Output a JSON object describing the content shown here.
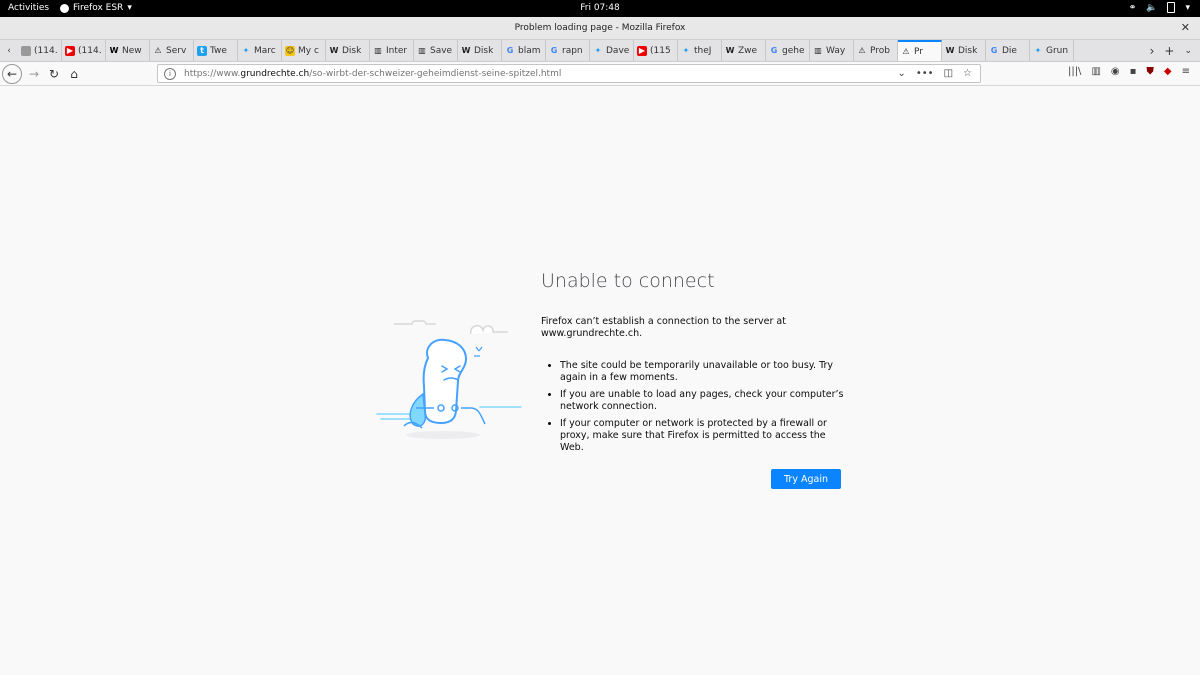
{
  "top_bar": {
    "activities": "Activities",
    "app_menu": "Firefox ESR",
    "clock": "Fri 07:48"
  },
  "window": {
    "title": "Problem loading page - Mozilla Firefox"
  },
  "tabs": [
    {
      "label": "(114…",
      "icon": "generic-page-icon"
    },
    {
      "label": "(114…",
      "icon": "youtube-icon"
    },
    {
      "label": "New",
      "icon": "wix-icon"
    },
    {
      "label": "Serv",
      "icon": "warning-icon"
    },
    {
      "label": "Twe",
      "icon": "tweetdeck-icon"
    },
    {
      "label": "Marc",
      "icon": "twitter-icon"
    },
    {
      "label": "My c",
      "icon": "emoji-icon"
    },
    {
      "label": "Disk",
      "icon": "wikipedia-icon"
    },
    {
      "label": "Inter",
      "icon": "archive-icon"
    },
    {
      "label": "Save",
      "icon": "archive-icon"
    },
    {
      "label": "Disk",
      "icon": "wikipedia-icon"
    },
    {
      "label": "blam",
      "icon": "google-icon"
    },
    {
      "label": "rapn",
      "icon": "google-icon"
    },
    {
      "label": "Dave",
      "icon": "twitter-icon"
    },
    {
      "label": "(115",
      "icon": "youtube-icon"
    },
    {
      "label": "theJ",
      "icon": "twitter-icon"
    },
    {
      "label": "Zwe",
      "icon": "wikipedia-icon"
    },
    {
      "label": "gehe",
      "icon": "google-icon"
    },
    {
      "label": "Way",
      "icon": "archive-icon"
    },
    {
      "label": "Prob",
      "icon": "warning-icon"
    },
    {
      "label": "Pr",
      "icon": "warning-icon",
      "active": true
    },
    {
      "label": "Disk",
      "icon": "wikipedia-icon"
    },
    {
      "label": "Die",
      "icon": "google-icon"
    },
    {
      "label": "Grun",
      "icon": "twitter-icon"
    }
  ],
  "url": {
    "prefix": "https://www.",
    "domain": "grundrechte.ch",
    "path": "/so-wirbt-der-schweizer-geheimdienst-seine-spitzel.html"
  },
  "error": {
    "title": "Unable to connect",
    "intro": "Firefox can’t establish a connection to the server at www.grundrechte.ch.",
    "bullets": [
      "The site could be temporarily unavailable or too busy. Try again in a few moments.",
      "If you are unable to load any pages, check your computer’s network connection.",
      "If your computer or network is protected by a firewall or proxy, make sure that Firefox is permitted to access the Web."
    ],
    "button": "Try Again"
  },
  "colors": {
    "accent": "#0a84ff",
    "page_bg": "#f9f9fa"
  }
}
